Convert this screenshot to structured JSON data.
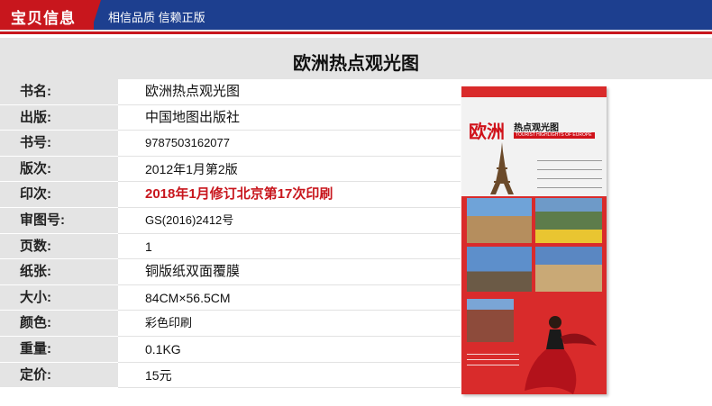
{
  "header": {
    "title": "宝贝信息",
    "slogan": "相信品质  信赖正版"
  },
  "product_title": "欧洲热点观光图",
  "rows": [
    {
      "label": "书名:",
      "value": "欧洲热点观光图"
    },
    {
      "label": "出版:",
      "value": "中国地图出版社"
    },
    {
      "label": "书号:",
      "value": "9787503162077"
    },
    {
      "label": "版次:",
      "value": "2012年1月第2版"
    },
    {
      "label": "印次:",
      "value": "2018年1月修订北京第17次印刷"
    },
    {
      "label": "审图号:",
      "value": "GS(2016)2412号"
    },
    {
      "label": "页数:",
      "value": "1"
    },
    {
      "label": "纸张:",
      "value": "铜版纸双面覆膜"
    },
    {
      "label": "大小:",
      "value": "84CM×56.5CM"
    },
    {
      "label": "颜色:",
      "value": "彩色印刷"
    },
    {
      "label": "重量:",
      "value": "0.1KG"
    },
    {
      "label": "定价:",
      "value": "15元"
    }
  ],
  "cover": {
    "title": "欧洲",
    "subtitle": "热点观光图",
    "english": "TOURIST HIGHLIGHTS OF EUROPE"
  },
  "colors": {
    "header_blue": "#1d3f8f",
    "brand_red": "#c8161d",
    "label_bg": "#e4e4e4"
  }
}
